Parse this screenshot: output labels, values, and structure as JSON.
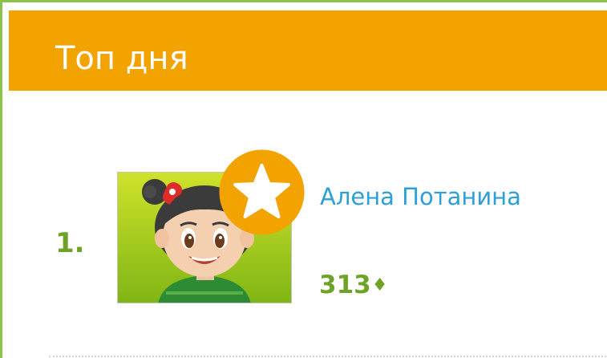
{
  "widget": {
    "title": "Топ дня"
  },
  "leaders": [
    {
      "rank": "1.",
      "name": "Алена Потанина",
      "score": "313",
      "score_icon": "diamond-icon",
      "badge_icon": "star-icon"
    }
  ],
  "colors": {
    "header_bg": "#f2a300",
    "frame_green": "#8bc34a",
    "score_green": "#6fa327",
    "link_blue": "#2ea0d8"
  }
}
